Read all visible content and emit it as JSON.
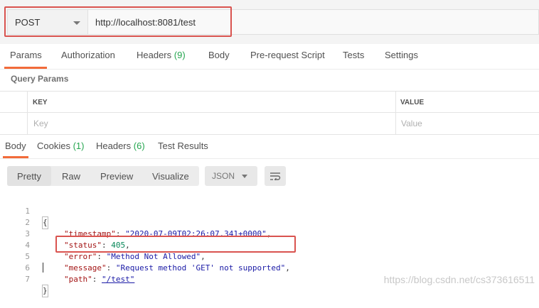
{
  "request": {
    "method": "POST",
    "url": "http://localhost:8081/test"
  },
  "request_tabs": [
    {
      "label": "Params",
      "count": ""
    },
    {
      "label": "Authorization",
      "count": ""
    },
    {
      "label": "Headers",
      "count": "(9)"
    },
    {
      "label": "Body",
      "count": ""
    },
    {
      "label": "Pre-request Script",
      "count": ""
    },
    {
      "label": "Tests",
      "count": ""
    },
    {
      "label": "Settings",
      "count": ""
    }
  ],
  "query_params": {
    "title": "Query Params",
    "columns": {
      "key": "KEY",
      "value": "VALUE"
    },
    "placeholders": {
      "key": "Key",
      "value": "Value"
    }
  },
  "response_tabs": [
    {
      "label": "Body",
      "count": ""
    },
    {
      "label": "Cookies",
      "count": "(1)"
    },
    {
      "label": "Headers",
      "count": "(6)"
    },
    {
      "label": "Test Results",
      "count": ""
    }
  ],
  "response_toolbar": {
    "formats": [
      "Pretty",
      "Raw",
      "Preview",
      "Visualize"
    ],
    "language": "JSON"
  },
  "response_body": {
    "line_numbers": [
      "1",
      "2",
      "3",
      "4",
      "5",
      "6",
      "7"
    ],
    "open_brace": "{",
    "close_brace": "}",
    "fields": [
      {
        "key": "\"timestamp\"",
        "value": "\"2020-07-09T02:26:07.341+0000\"",
        "type": "string"
      },
      {
        "key": "\"status\"",
        "value": "405",
        "type": "number"
      },
      {
        "key": "\"error\"",
        "value": "\"Method Not Allowed\"",
        "type": "string"
      },
      {
        "key": "\"message\"",
        "value": "\"Request method 'GET' not supported\"",
        "type": "string"
      },
      {
        "key": "\"path\"",
        "value": "\"/test\"",
        "type": "link"
      }
    ]
  },
  "watermark": "https://blog.csdn.net/cs373616511",
  "colors": {
    "accent": "#f26b3a",
    "highlight": "#d9534f",
    "count": "#26a650"
  }
}
